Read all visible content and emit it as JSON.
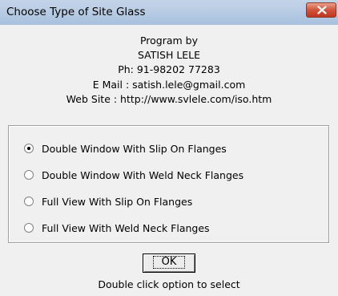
{
  "window": {
    "title": "Choose Type of Site Glass"
  },
  "info": {
    "line1": "Program by",
    "line2": "SATISH LELE",
    "line3": "Ph: 91-98202 77283",
    "line4": "E Mail : satish.lele@gmail.com",
    "line5": "Web Site : http://www.svlele.com/iso.htm"
  },
  "options": [
    {
      "label": "Double Window With Slip On Flanges",
      "checked": true
    },
    {
      "label": "Double Window With Weld Neck Flanges",
      "checked": false
    },
    {
      "label": "Full View With Slip On Flanges",
      "checked": false
    },
    {
      "label": "Full View With Weld Neck Flanges",
      "checked": false
    }
  ],
  "ok_button": {
    "label": "OK"
  },
  "hint": "Double click option to select",
  "icons": {
    "close": "close-icon"
  },
  "colors": {
    "titlebar": "#b9cde4",
    "close_button": "#d1533a",
    "dialog_bg": "#f0f0f0"
  }
}
